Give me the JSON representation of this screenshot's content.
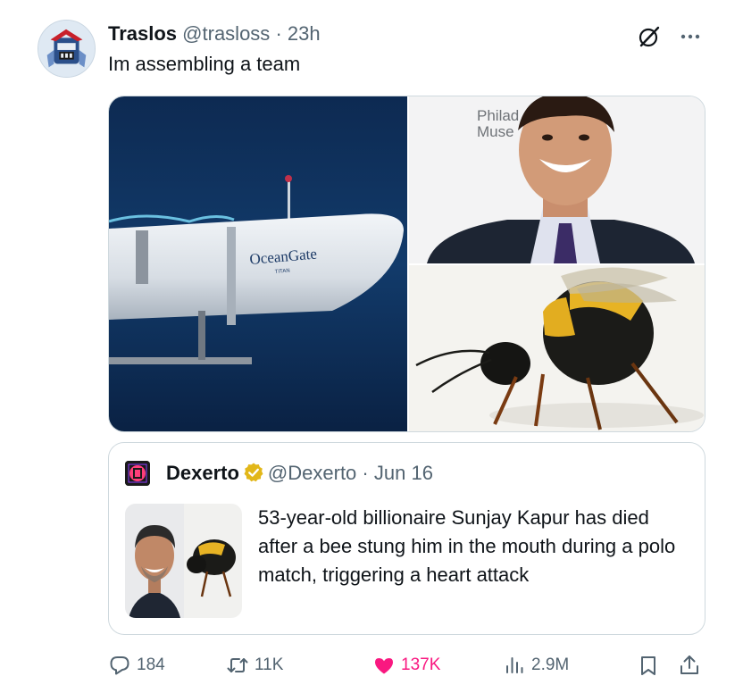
{
  "tweet": {
    "display_name": "Traslos",
    "handle": "@trasloss",
    "separator": "·",
    "time": "23h",
    "text": "Im assembling a team",
    "media": {
      "submarine_label": "OceanGate",
      "submarine_sublabel": "TITAN",
      "backdrop_text_line1": "Philad",
      "backdrop_text_line2": "Muse"
    }
  },
  "quote": {
    "display_name": "Dexerto",
    "handle": "@Dexerto",
    "separator": "·",
    "date": "Jun 16",
    "text": "53-year-old billionaire Sunjay Kapur has died after a bee stung him in the mouth during a polo match, triggering a heart attack"
  },
  "actions": {
    "replies": "184",
    "retweets": "11K",
    "likes": "137K",
    "views": "2.9M",
    "liked": true
  },
  "colors": {
    "like_active": "#f91880",
    "secondary_text": "#536471",
    "border": "#cfd9de",
    "verified_gold": "#e2b719"
  },
  "icons": [
    "grok-icon",
    "more-icon",
    "verified-gold-icon",
    "reply-icon",
    "retweet-icon",
    "heart-icon",
    "views-icon",
    "bookmark-icon",
    "share-icon"
  ]
}
